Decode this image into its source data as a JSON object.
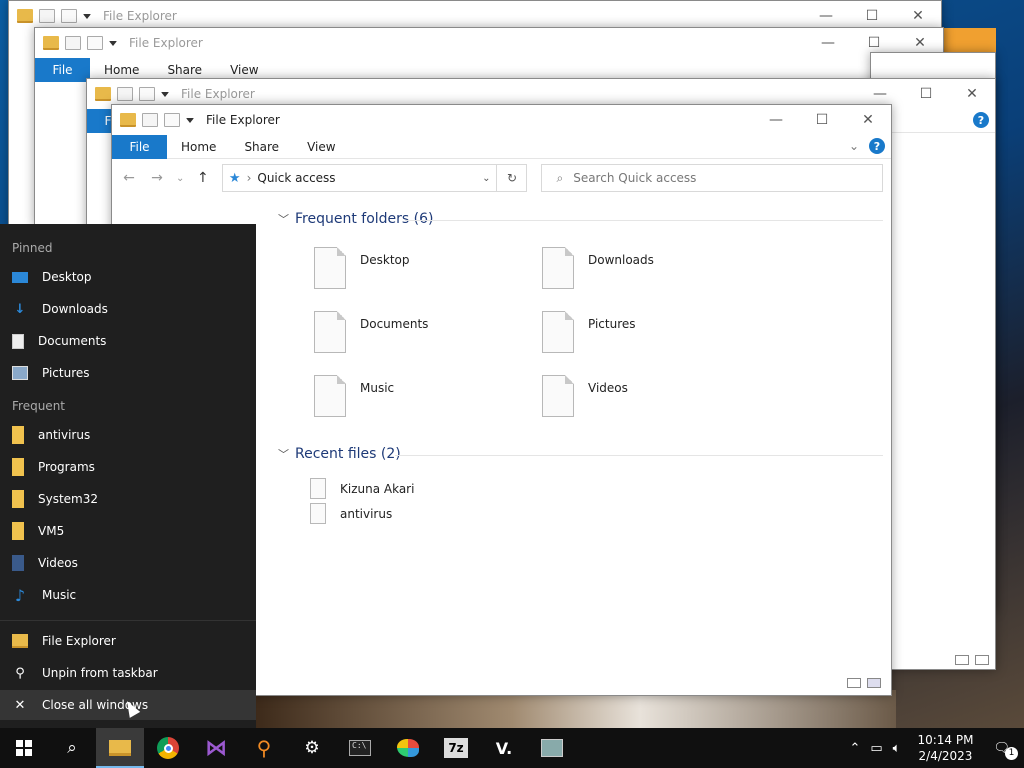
{
  "window": {
    "title": "File Explorer",
    "controls": {
      "minimize": "—",
      "maximize": "☐",
      "close": "✕"
    }
  },
  "ribbon": {
    "file": "File",
    "tabs": [
      "Home",
      "Share",
      "View"
    ],
    "help": "?"
  },
  "nav": {
    "back": "←",
    "forward": "→",
    "recent": "⌄",
    "up": "↑",
    "address": "Quick access",
    "search_placeholder": "Search Quick access"
  },
  "frequent_folders": {
    "header": "Frequent folders (6)",
    "items": [
      "Desktop",
      "Downloads",
      "Documents",
      "Pictures",
      "Music",
      "Videos"
    ]
  },
  "recent_files": {
    "header": "Recent files (2)",
    "items": [
      "Kizuna Akari",
      "antivirus"
    ]
  },
  "jump_list": {
    "pinned_header": "Pinned",
    "pinned": [
      "Desktop",
      "Downloads",
      "Documents",
      "Pictures"
    ],
    "frequent_header": "Frequent",
    "frequent": [
      "antivirus",
      "Programs",
      "System32",
      "VM5",
      "Videos",
      "Music"
    ],
    "tasks": [
      "File Explorer",
      "Unpin from taskbar",
      "Close all windows"
    ]
  },
  "taskbar": {
    "time": "10:14 PM",
    "date": "2/4/2023",
    "notification_count": "1",
    "apps": [
      "start",
      "search",
      "file-explorer",
      "chrome",
      "visual-studio",
      "magnifier",
      "settings",
      "terminal",
      "paint",
      "7zip",
      "v-app",
      "network-app"
    ]
  }
}
